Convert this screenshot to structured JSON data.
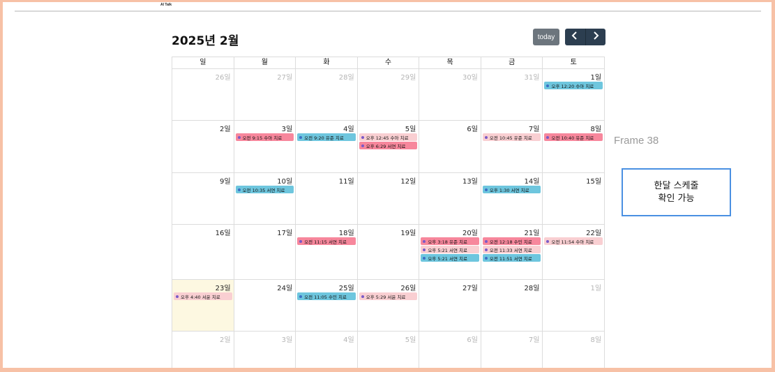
{
  "app": {
    "title": "AI Talk"
  },
  "header": {
    "month_title": "2025년 2월",
    "today_label": "today",
    "prev_icon": "chevron-left-icon",
    "next_icon": "chevron-right-icon"
  },
  "weekdays": [
    "일",
    "월",
    "화",
    "수",
    "목",
    "금",
    "토"
  ],
  "colors": {
    "blue_event": "#6ec6de",
    "pink_event": "#f7879c",
    "lightpink_event": "#f9cfd2",
    "today_bg": "#fdf8e1"
  },
  "weeks": [
    [
      {
        "label": "26일",
        "other": true,
        "events": []
      },
      {
        "label": "27일",
        "other": true,
        "events": []
      },
      {
        "label": "28일",
        "other": true,
        "events": []
      },
      {
        "label": "29일",
        "other": true,
        "events": []
      },
      {
        "label": "30일",
        "other": true,
        "events": []
      },
      {
        "label": "31일",
        "other": true,
        "events": []
      },
      {
        "label": "1일",
        "other": false,
        "events": [
          {
            "text": "오후 12:20 수아 치료",
            "color": "blue",
            "dot": "blue"
          }
        ]
      }
    ],
    [
      {
        "label": "2일",
        "other": false,
        "events": []
      },
      {
        "label": "3일",
        "other": false,
        "events": [
          {
            "text": "오전 9:15 수아 치료",
            "color": "pink",
            "dot": "purple"
          }
        ]
      },
      {
        "label": "4일",
        "other": false,
        "events": [
          {
            "text": "오전 9:20 유준 치료",
            "color": "blue",
            "dot": "blue"
          }
        ]
      },
      {
        "label": "5일",
        "other": false,
        "events": [
          {
            "text": "오후 12:45 수아 치료",
            "color": "lightpink",
            "dot": "purple"
          },
          {
            "text": "오후 6:29 서연 치료",
            "color": "pink",
            "dot": "purple"
          }
        ]
      },
      {
        "label": "6일",
        "other": false,
        "events": []
      },
      {
        "label": "7일",
        "other": false,
        "events": [
          {
            "text": "오전 10:45 유준 치료",
            "color": "lightpink",
            "dot": "purple"
          }
        ]
      },
      {
        "label": "8일",
        "other": false,
        "events": [
          {
            "text": "오전 10:40 유준 치료",
            "color": "pink",
            "dot": "purple"
          }
        ]
      }
    ],
    [
      {
        "label": "9일",
        "other": false,
        "events": []
      },
      {
        "label": "10일",
        "other": false,
        "events": [
          {
            "text": "오전 10:35 서연 치료",
            "color": "blue",
            "dot": "blue"
          }
        ]
      },
      {
        "label": "11일",
        "other": false,
        "events": []
      },
      {
        "label": "12일",
        "other": false,
        "events": []
      },
      {
        "label": "13일",
        "other": false,
        "events": []
      },
      {
        "label": "14일",
        "other": false,
        "events": [
          {
            "text": "오후 1:30 서연 치료",
            "color": "blue",
            "dot": "blue"
          }
        ]
      },
      {
        "label": "15일",
        "other": false,
        "events": []
      }
    ],
    [
      {
        "label": "16일",
        "other": false,
        "events": []
      },
      {
        "label": "17일",
        "other": false,
        "events": []
      },
      {
        "label": "18일",
        "other": false,
        "events": [
          {
            "text": "오전 11:15 서연 치료",
            "color": "pink",
            "dot": "purple"
          }
        ]
      },
      {
        "label": "19일",
        "other": false,
        "events": []
      },
      {
        "label": "20일",
        "other": false,
        "events": [
          {
            "text": "오후 3:18 유준 치료",
            "color": "pink",
            "dot": "purple"
          },
          {
            "text": "오후 5:21 서연 치료",
            "color": "lightpink",
            "dot": "purple"
          },
          {
            "text": "오후 5:21 서연 치료",
            "color": "blue",
            "dot": "blue"
          }
        ]
      },
      {
        "label": "21일",
        "other": false,
        "events": [
          {
            "text": "오전 12:18 수민 치료",
            "color": "pink",
            "dot": "purple"
          },
          {
            "text": "오전 11:33 서연 치료",
            "color": "lightpink",
            "dot": "purple"
          },
          {
            "text": "오전 11:51 서연 치료",
            "color": "blue",
            "dot": "blue"
          }
        ]
      },
      {
        "label": "22일",
        "other": false,
        "events": [
          {
            "text": "오전 11:54 수아 치료",
            "color": "lightpink",
            "dot": "purple"
          }
        ]
      }
    ],
    [
      {
        "label": "23일",
        "other": false,
        "today": true,
        "events": [
          {
            "text": "오후 4:40 서윤 치료",
            "color": "lightpink",
            "dot": "purple"
          }
        ]
      },
      {
        "label": "24일",
        "other": false,
        "events": []
      },
      {
        "label": "25일",
        "other": false,
        "events": [
          {
            "text": "오전 11:05 수민 치료",
            "color": "blue",
            "dot": "blue"
          }
        ]
      },
      {
        "label": "26일",
        "other": false,
        "events": [
          {
            "text": "오후 5:29 서윤 치료",
            "color": "lightpink",
            "dot": "purple"
          }
        ]
      },
      {
        "label": "27일",
        "other": false,
        "events": []
      },
      {
        "label": "28일",
        "other": false,
        "events": []
      },
      {
        "label": "1일",
        "other": true,
        "events": []
      }
    ],
    [
      {
        "label": "2일",
        "other": true,
        "events": []
      },
      {
        "label": "3일",
        "other": true,
        "events": []
      },
      {
        "label": "4일",
        "other": true,
        "events": []
      },
      {
        "label": "5일",
        "other": true,
        "events": []
      },
      {
        "label": "6일",
        "other": true,
        "events": []
      },
      {
        "label": "7일",
        "other": true,
        "events": []
      },
      {
        "label": "8일",
        "other": true,
        "events": []
      }
    ]
  ],
  "side": {
    "frame_label": "Frame 38",
    "note_line1": "한달 스케줄",
    "note_line2": "확인 가능"
  }
}
